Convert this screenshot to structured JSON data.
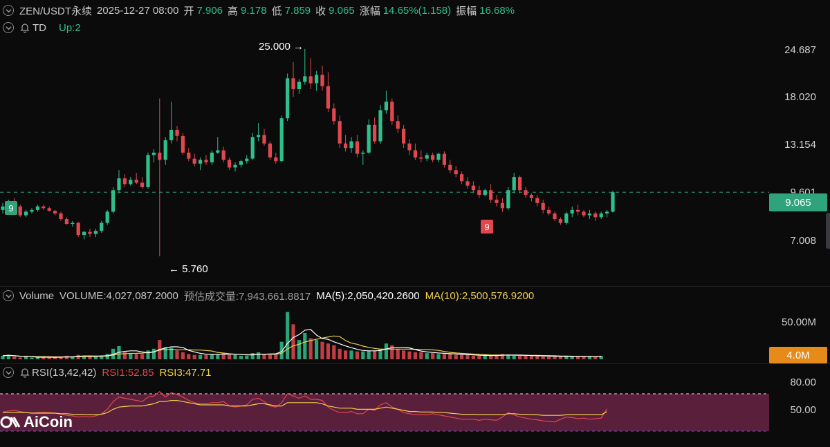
{
  "header": {
    "symbol": "ZEN/USDT永续",
    "datetime": "2025-12-27 08:00",
    "open_label": "开",
    "open": "7.906",
    "high_label": "高",
    "high": "9.178",
    "low_label": "低",
    "low": "7.859",
    "close_label": "收",
    "close": "9.065",
    "change_label": "涨幅",
    "change": "14.65%(1.158)",
    "amplitude_label": "振幅",
    "amplitude": "16.68%"
  },
  "indicator_row": {
    "name": "TD",
    "value": "Up:2"
  },
  "price_axis": {
    "ticks": [
      "24.687",
      "18.020",
      "13.154",
      "9.601",
      "7.008"
    ]
  },
  "current_price": "9.065",
  "annotations": {
    "high": "25.000",
    "low": "5.760",
    "td_top": "9",
    "td_bottom": "9"
  },
  "volume": {
    "title": "Volume",
    "volume_label": "VOLUME:4,027,087.2000",
    "estimate_label": "预估成交量:7,943,661.8817",
    "ma5_label": "MA(5):2,050,420.2600",
    "ma10_label": "MA(10):2,500,576.9200",
    "axis_tick": "50.00M",
    "current_tag": "4.0M"
  },
  "rsi": {
    "title": "RSI(13,42,42)",
    "rsi1_label": "RSI1:52.85",
    "rsi3_label": "RSI3:47.71",
    "ticks": [
      "80.00",
      "50.00"
    ]
  },
  "logo": {
    "text": "AiCoin"
  },
  "colors": {
    "up": "#2fbf8b",
    "down": "#e0484f",
    "ma5": "#ffffff",
    "ma10": "#f0d24a",
    "rsi_band": "#5a1f3a",
    "price_tag": "#2fa37b",
    "volume_tag": "#e68a1a"
  },
  "chart_data": {
    "type": "candlestick",
    "candles": [
      {
        "o": 8.0,
        "h": 8.4,
        "l": 7.8,
        "c": 8.2
      },
      {
        "o": 8.2,
        "h": 8.6,
        "l": 8.0,
        "c": 8.4
      },
      {
        "o": 8.4,
        "h": 8.7,
        "l": 8.1,
        "c": 8.2
      },
      {
        "o": 8.2,
        "h": 8.3,
        "l": 7.6,
        "c": 7.7
      },
      {
        "o": 7.7,
        "h": 8.0,
        "l": 7.6,
        "c": 7.9
      },
      {
        "o": 7.9,
        "h": 8.1,
        "l": 7.8,
        "c": 8.0
      },
      {
        "o": 8.0,
        "h": 8.3,
        "l": 7.9,
        "c": 8.2
      },
      {
        "o": 8.2,
        "h": 8.3,
        "l": 8.0,
        "c": 8.1
      },
      {
        "o": 8.1,
        "h": 8.2,
        "l": 7.9,
        "c": 7.95
      },
      {
        "o": 7.95,
        "h": 8.0,
        "l": 7.7,
        "c": 7.8
      },
      {
        "o": 7.8,
        "h": 7.9,
        "l": 7.4,
        "c": 7.5
      },
      {
        "o": 7.5,
        "h": 7.6,
        "l": 7.2,
        "c": 7.25
      },
      {
        "o": 7.25,
        "h": 7.4,
        "l": 7.1,
        "c": 7.3
      },
      {
        "o": 7.3,
        "h": 7.35,
        "l": 6.6,
        "c": 6.7
      },
      {
        "o": 6.7,
        "h": 6.9,
        "l": 6.5,
        "c": 6.85
      },
      {
        "o": 6.85,
        "h": 7.0,
        "l": 6.6,
        "c": 6.75
      },
      {
        "o": 6.75,
        "h": 7.0,
        "l": 6.6,
        "c": 6.9
      },
      {
        "o": 6.9,
        "h": 7.4,
        "l": 6.8,
        "c": 7.3
      },
      {
        "o": 7.3,
        "h": 8.0,
        "l": 7.2,
        "c": 7.9
      },
      {
        "o": 7.9,
        "h": 9.4,
        "l": 7.8,
        "c": 9.2
      },
      {
        "o": 9.2,
        "h": 10.6,
        "l": 9.0,
        "c": 10.0
      },
      {
        "o": 10.0,
        "h": 10.3,
        "l": 9.4,
        "c": 9.6
      },
      {
        "o": 9.6,
        "h": 10.1,
        "l": 9.5,
        "c": 9.9
      },
      {
        "o": 9.9,
        "h": 10.4,
        "l": 9.6,
        "c": 9.7
      },
      {
        "o": 9.7,
        "h": 10.1,
        "l": 9.3,
        "c": 9.4
      },
      {
        "o": 9.4,
        "h": 12.0,
        "l": 9.3,
        "c": 11.8
      },
      {
        "o": 11.8,
        "h": 12.3,
        "l": 11.2,
        "c": 12.0
      },
      {
        "o": 12.0,
        "h": 17.6,
        "l": 5.76,
        "c": 11.4
      },
      {
        "o": 11.4,
        "h": 13.4,
        "l": 11.0,
        "c": 13.1
      },
      {
        "o": 13.1,
        "h": 17.2,
        "l": 12.8,
        "c": 14.1
      },
      {
        "o": 14.1,
        "h": 14.5,
        "l": 13.0,
        "c": 13.5
      },
      {
        "o": 13.5,
        "h": 13.8,
        "l": 11.8,
        "c": 12.0
      },
      {
        "o": 12.0,
        "h": 12.4,
        "l": 11.3,
        "c": 11.5
      },
      {
        "o": 11.5,
        "h": 11.9,
        "l": 10.9,
        "c": 11.1
      },
      {
        "o": 11.1,
        "h": 11.6,
        "l": 10.6,
        "c": 11.4
      },
      {
        "o": 11.4,
        "h": 11.8,
        "l": 11.0,
        "c": 11.2
      },
      {
        "o": 11.2,
        "h": 12.2,
        "l": 11.0,
        "c": 12.0
      },
      {
        "o": 12.0,
        "h": 13.4,
        "l": 11.9,
        "c": 12.2
      },
      {
        "o": 12.2,
        "h": 12.5,
        "l": 11.2,
        "c": 11.4
      },
      {
        "o": 11.4,
        "h": 11.6,
        "l": 10.6,
        "c": 10.8
      },
      {
        "o": 10.8,
        "h": 11.2,
        "l": 10.5,
        "c": 11.0
      },
      {
        "o": 11.0,
        "h": 11.4,
        "l": 10.8,
        "c": 11.3
      },
      {
        "o": 11.3,
        "h": 11.8,
        "l": 11.1,
        "c": 11.5
      },
      {
        "o": 11.5,
        "h": 13.8,
        "l": 11.4,
        "c": 13.4
      },
      {
        "o": 13.4,
        "h": 14.8,
        "l": 13.0,
        "c": 13.6
      },
      {
        "o": 13.6,
        "h": 14.2,
        "l": 12.6,
        "c": 12.8
      },
      {
        "o": 12.8,
        "h": 13.0,
        "l": 11.4,
        "c": 11.6
      },
      {
        "o": 11.6,
        "h": 12.0,
        "l": 11.1,
        "c": 11.3
      },
      {
        "o": 11.3,
        "h": 15.6,
        "l": 11.2,
        "c": 15.3
      },
      {
        "o": 15.3,
        "h": 21.0,
        "l": 15.0,
        "c": 20.3
      },
      {
        "o": 20.3,
        "h": 22.8,
        "l": 17.8,
        "c": 18.8
      },
      {
        "o": 18.8,
        "h": 20.2,
        "l": 18.2,
        "c": 19.8
      },
      {
        "o": 19.8,
        "h": 25.0,
        "l": 19.4,
        "c": 20.6
      },
      {
        "o": 20.6,
        "h": 23.4,
        "l": 18.8,
        "c": 19.6
      },
      {
        "o": 19.6,
        "h": 21.4,
        "l": 18.6,
        "c": 20.8
      },
      {
        "o": 20.8,
        "h": 22.2,
        "l": 18.6,
        "c": 19.2
      },
      {
        "o": 19.2,
        "h": 21.2,
        "l": 16.0,
        "c": 16.4
      },
      {
        "o": 16.4,
        "h": 17.0,
        "l": 14.6,
        "c": 15.0
      },
      {
        "o": 15.0,
        "h": 15.6,
        "l": 12.4,
        "c": 12.8
      },
      {
        "o": 12.8,
        "h": 13.6,
        "l": 12.1,
        "c": 12.4
      },
      {
        "o": 12.4,
        "h": 13.4,
        "l": 12.0,
        "c": 13.0
      },
      {
        "o": 13.0,
        "h": 13.6,
        "l": 11.6,
        "c": 11.9
      },
      {
        "o": 11.9,
        "h": 12.2,
        "l": 11.0,
        "c": 12.0
      },
      {
        "o": 12.0,
        "h": 15.2,
        "l": 11.9,
        "c": 14.6
      },
      {
        "o": 14.6,
        "h": 15.4,
        "l": 12.8,
        "c": 13.0
      },
      {
        "o": 13.0,
        "h": 16.8,
        "l": 12.8,
        "c": 16.2
      },
      {
        "o": 16.2,
        "h": 18.6,
        "l": 15.8,
        "c": 17.2
      },
      {
        "o": 17.2,
        "h": 17.6,
        "l": 14.6,
        "c": 15.0
      },
      {
        "o": 15.0,
        "h": 15.6,
        "l": 13.8,
        "c": 14.2
      },
      {
        "o": 14.2,
        "h": 14.6,
        "l": 12.4,
        "c": 12.8
      },
      {
        "o": 12.8,
        "h": 13.2,
        "l": 11.8,
        "c": 12.2
      },
      {
        "o": 12.2,
        "h": 12.8,
        "l": 11.4,
        "c": 11.6
      },
      {
        "o": 11.6,
        "h": 12.2,
        "l": 11.2,
        "c": 11.5
      },
      {
        "o": 11.5,
        "h": 12.0,
        "l": 11.3,
        "c": 11.8
      },
      {
        "o": 11.8,
        "h": 12.0,
        "l": 11.2,
        "c": 11.4
      },
      {
        "o": 11.4,
        "h": 12.0,
        "l": 11.2,
        "c": 11.9
      },
      {
        "o": 11.9,
        "h": 12.1,
        "l": 10.8,
        "c": 11.0
      },
      {
        "o": 11.0,
        "h": 11.4,
        "l": 10.4,
        "c": 10.6
      },
      {
        "o": 10.6,
        "h": 10.9,
        "l": 10.1,
        "c": 10.3
      },
      {
        "o": 10.3,
        "h": 10.5,
        "l": 9.6,
        "c": 9.8
      },
      {
        "o": 9.8,
        "h": 10.1,
        "l": 9.3,
        "c": 9.5
      },
      {
        "o": 9.5,
        "h": 9.8,
        "l": 9.0,
        "c": 9.2
      },
      {
        "o": 9.2,
        "h": 9.5,
        "l": 8.7,
        "c": 8.9
      },
      {
        "o": 8.9,
        "h": 9.3,
        "l": 8.8,
        "c": 9.2
      },
      {
        "o": 9.2,
        "h": 9.6,
        "l": 8.4,
        "c": 8.6
      },
      {
        "o": 8.6,
        "h": 8.9,
        "l": 8.2,
        "c": 8.4
      },
      {
        "o": 8.4,
        "h": 8.7,
        "l": 7.9,
        "c": 8.1
      },
      {
        "o": 8.1,
        "h": 9.4,
        "l": 8.0,
        "c": 9.2
      },
      {
        "o": 9.2,
        "h": 10.4,
        "l": 9.0,
        "c": 10.1
      },
      {
        "o": 10.1,
        "h": 10.2,
        "l": 9.0,
        "c": 9.2
      },
      {
        "o": 9.2,
        "h": 9.4,
        "l": 8.7,
        "c": 8.9
      },
      {
        "o": 8.9,
        "h": 9.0,
        "l": 8.5,
        "c": 8.7
      },
      {
        "o": 8.7,
        "h": 8.9,
        "l": 8.2,
        "c": 8.4
      },
      {
        "o": 8.4,
        "h": 8.6,
        "l": 7.8,
        "c": 8.0
      },
      {
        "o": 8.0,
        "h": 8.2,
        "l": 7.7,
        "c": 7.8
      },
      {
        "o": 7.8,
        "h": 7.9,
        "l": 7.4,
        "c": 7.5
      },
      {
        "o": 7.5,
        "h": 7.6,
        "l": 7.2,
        "c": 7.3
      },
      {
        "o": 7.3,
        "h": 7.9,
        "l": 7.2,
        "c": 7.8
      },
      {
        "o": 7.8,
        "h": 8.2,
        "l": 7.6,
        "c": 8.0
      },
      {
        "o": 8.0,
        "h": 8.3,
        "l": 7.7,
        "c": 7.9
      },
      {
        "o": 7.9,
        "h": 8.0,
        "l": 7.6,
        "c": 7.7
      },
      {
        "o": 7.7,
        "h": 8.0,
        "l": 7.5,
        "c": 7.8
      },
      {
        "o": 7.8,
        "h": 7.9,
        "l": 7.4,
        "c": 7.6
      },
      {
        "o": 7.6,
        "h": 7.9,
        "l": 7.5,
        "c": 7.8
      },
      {
        "o": 7.8,
        "h": 8.0,
        "l": 7.6,
        "c": 7.9
      },
      {
        "o": 7.9,
        "h": 9.18,
        "l": 7.86,
        "c": 9.065
      }
    ],
    "volumes": [
      4,
      5,
      3,
      2,
      3,
      2,
      2,
      3,
      2,
      2,
      3,
      4,
      3,
      5,
      4,
      3,
      3,
      4,
      6,
      12,
      15,
      8,
      7,
      6,
      6,
      10,
      12,
      22,
      14,
      13,
      10,
      8,
      6,
      5,
      5,
      5,
      6,
      6,
      7,
      5,
      5,
      4,
      4,
      7,
      8,
      6,
      5,
      5,
      20,
      54,
      40,
      22,
      30,
      24,
      22,
      20,
      18,
      16,
      12,
      10,
      10,
      9,
      9,
      10,
      10,
      12,
      18,
      16,
      12,
      10,
      9,
      8,
      8,
      7,
      7,
      6,
      6,
      6,
      5,
      5,
      5,
      4,
      4,
      4,
      4,
      5,
      6,
      5,
      4,
      4,
      4,
      4,
      4,
      3,
      3,
      3,
      3,
      4,
      3,
      3,
      3,
      3,
      3,
      4
    ],
    "volume_ylim": [
      0,
      60
    ],
    "rsi1": [
      47,
      49,
      50,
      48,
      46,
      45,
      46,
      47,
      46,
      45,
      43,
      41,
      40,
      38,
      39,
      38,
      40,
      44,
      52,
      66,
      74,
      72,
      70,
      68,
      66,
      74,
      76,
      84,
      74,
      82,
      79,
      74,
      68,
      64,
      62,
      62,
      64,
      64,
      66,
      58,
      56,
      58,
      60,
      70,
      72,
      66,
      58,
      56,
      64,
      80,
      76,
      72,
      76,
      70,
      70,
      68,
      56,
      50,
      46,
      46,
      48,
      44,
      44,
      52,
      50,
      60,
      64,
      56,
      52,
      46,
      44,
      42,
      42,
      42,
      44,
      42,
      40,
      38,
      36,
      34,
      34,
      34,
      32,
      34,
      33,
      32,
      38,
      46,
      42,
      38,
      36,
      34,
      33,
      31,
      30,
      29,
      34,
      38,
      37,
      35,
      36,
      34,
      35,
      36,
      52.85
    ],
    "rsi3": [
      46,
      46,
      46,
      46,
      46,
      45,
      45,
      45,
      45,
      45,
      44,
      44,
      43,
      43,
      43,
      42,
      42,
      43,
      46,
      52,
      56,
      57,
      58,
      58,
      58,
      60,
      62,
      66,
      66,
      68,
      68,
      66,
      64,
      62,
      60,
      60,
      60,
      60,
      60,
      58,
      58,
      58,
      58,
      60,
      62,
      62,
      60,
      58,
      58,
      64,
      64,
      64,
      64,
      64,
      64,
      62,
      58,
      56,
      54,
      54,
      54,
      52,
      52,
      52,
      52,
      54,
      56,
      54,
      52,
      50,
      48,
      48,
      47,
      47,
      47,
      46,
      46,
      45,
      44,
      43,
      43,
      43,
      42,
      42,
      42,
      42,
      42,
      44,
      44,
      43,
      43,
      42,
      42,
      41,
      41,
      41,
      41,
      42,
      42,
      42,
      42,
      42,
      42,
      42,
      47.71
    ],
    "price_ylim": [
      5.0,
      27.0
    ],
    "rsi_ylim": [
      0,
      100
    ]
  }
}
